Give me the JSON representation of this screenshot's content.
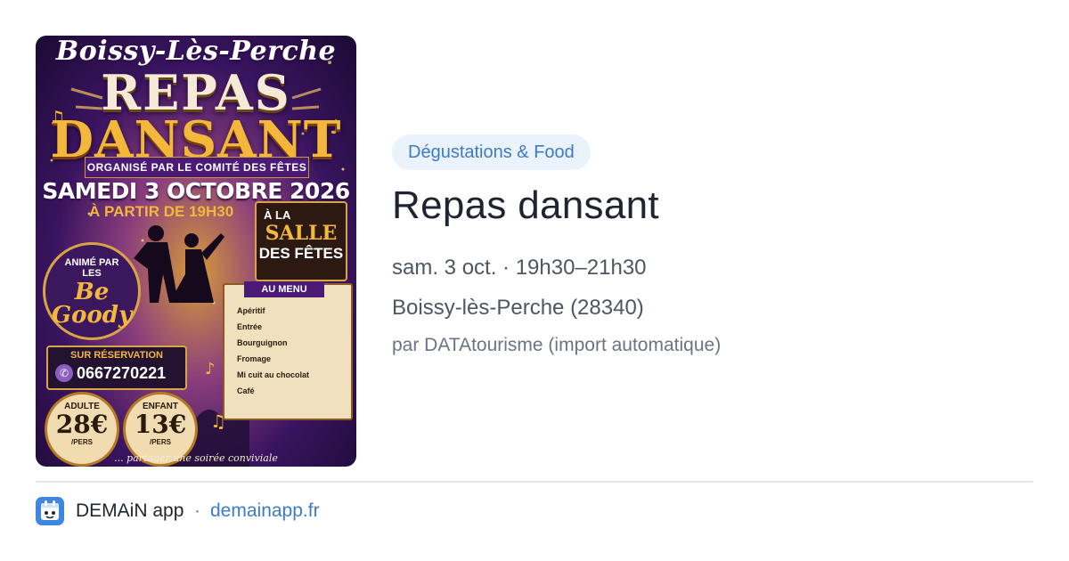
{
  "poster": {
    "town": "Boissy-Lès-Perche",
    "line1": "REPAS",
    "line2": "DANSANT",
    "organizer": "ORGANISÉ PAR LE COMITÉ DES FÊTES",
    "date": "SAMEDI 3 OCTOBRE 2026",
    "start_time": "À PARTIR DE 19H30",
    "venue_prefix": "À LA",
    "venue_line1": "SALLE",
    "venue_line2": "DES FÊTES",
    "animation_label": "ANIMÉ PAR",
    "animation_les": "LES",
    "band_name": "Be Goody",
    "menu_title": "AU MENU",
    "menu_items": [
      "Apéritif",
      "Entrée",
      "Bourguignon",
      "Fromage",
      "Mi cuit au chocolat",
      "Café"
    ],
    "reservation_label": "SUR RÉSERVATION",
    "phone": "0667270221",
    "adult_label": "ADULTE",
    "adult_price": "28€",
    "child_label": "ENFANT",
    "child_price": "13€",
    "per_person": "/PERS",
    "footer_text": "... partager une soirée conviviale"
  },
  "event": {
    "category": "Dégustations & Food",
    "title": "Repas dansant",
    "when": "sam. 3 oct. · 19h30–21h30",
    "where": "Boissy-lès-Perche (28340)",
    "source": "par DATAtourisme (import automatique)"
  },
  "footer": {
    "app_name": "DEMAiN app",
    "separator": "·",
    "site": "demainapp.fr"
  },
  "colors": {
    "accent": "#3d7bc9",
    "chip_bg": "#eaf2fb",
    "text": "#1f2530",
    "muted": "#4d5663",
    "divider": "#e2e8ee"
  },
  "icons": {
    "app": "demain-app-icon",
    "phone": "phone-icon"
  }
}
